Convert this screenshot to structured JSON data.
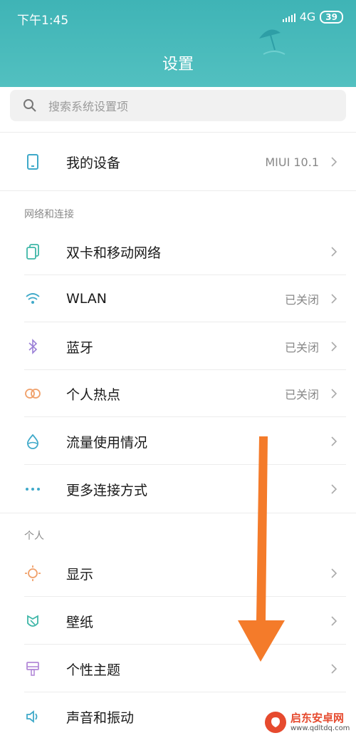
{
  "status_bar": {
    "time": "下午1:45",
    "network": "4G",
    "battery": "39"
  },
  "header": {
    "title": "设置"
  },
  "search": {
    "placeholder": "搜索系统设置项"
  },
  "device": {
    "label": "我的设备",
    "value": "MIUI 10.1"
  },
  "sections": {
    "network": "网络和连接",
    "personal": "个人"
  },
  "network_items": [
    {
      "label": "双卡和移动网络",
      "value": "",
      "icon": "dual-sim-icon"
    },
    {
      "label": "WLAN",
      "value": "已关闭",
      "icon": "wifi-icon"
    },
    {
      "label": "蓝牙",
      "value": "已关闭",
      "icon": "bluetooth-icon"
    },
    {
      "label": "个人热点",
      "value": "已关闭",
      "icon": "hotspot-icon"
    },
    {
      "label": "流量使用情况",
      "value": "",
      "icon": "data-usage-icon"
    },
    {
      "label": "更多连接方式",
      "value": "",
      "icon": "more-icon"
    }
  ],
  "personal_items": [
    {
      "label": "显示",
      "icon": "display-icon"
    },
    {
      "label": "壁纸",
      "icon": "wallpaper-icon"
    },
    {
      "label": "个性主题",
      "icon": "theme-icon"
    },
    {
      "label": "声音和振动",
      "icon": "sound-icon"
    }
  ],
  "watermark": {
    "name": "启东安卓网",
    "url": "www.qdltdq.com"
  },
  "colors": {
    "header": "#45b8b9",
    "arrow": "#f47b2a"
  }
}
